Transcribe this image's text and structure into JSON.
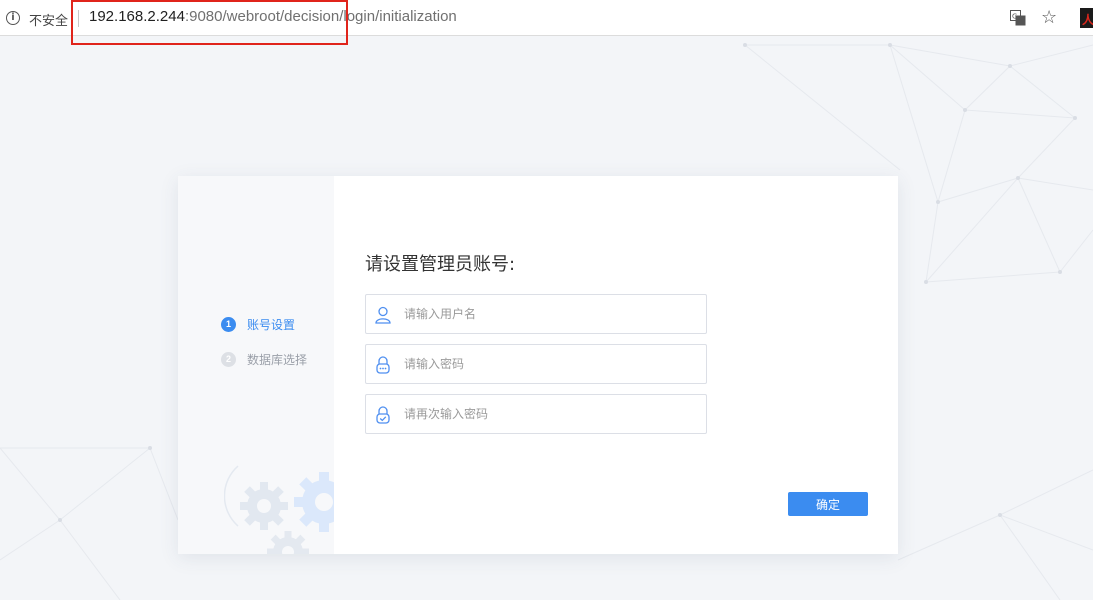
{
  "browser": {
    "security_label": "不安全",
    "url_host": "192.168.2.244",
    "url_path": ":9080/webroot/decision/login/initialization"
  },
  "colors": {
    "accent": "#3b8cf0",
    "highlight_box": "#e0241b",
    "background": "#f3f5f8"
  },
  "steps": [
    {
      "number": "1",
      "label": "账号设置",
      "state": "active"
    },
    {
      "number": "2",
      "label": "数据库选择",
      "state": "inactive"
    }
  ],
  "form": {
    "title": "请设置管理员账号:",
    "username": {
      "value": "",
      "placeholder": "请输入用户名",
      "icon": "user-icon"
    },
    "password": {
      "value": "",
      "placeholder": "请输入密码",
      "icon": "lock-icon"
    },
    "password_confirm": {
      "value": "",
      "placeholder": "请再次输入密码",
      "icon": "lock-check-icon"
    },
    "confirm_label": "确定"
  }
}
